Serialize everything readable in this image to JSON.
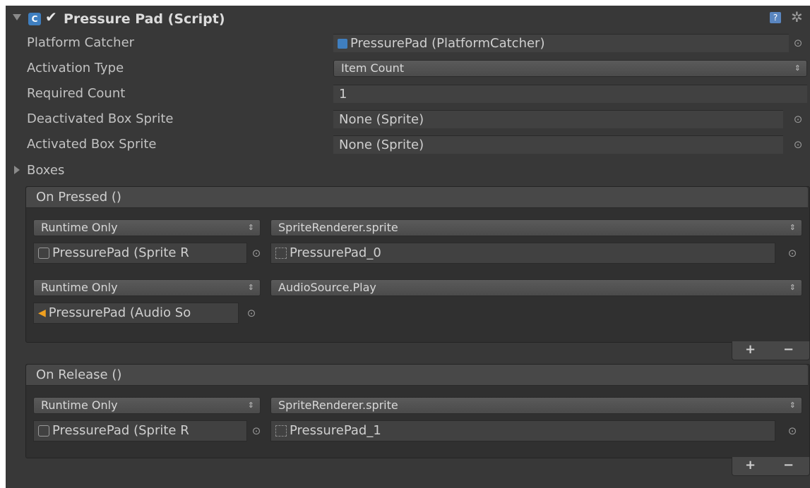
{
  "component": {
    "title": "Pressure Pad (Script)",
    "enabled": true,
    "icons": [
      "script-icon",
      "help-icon",
      "gear-icon",
      "foldout-arrow-icon"
    ]
  },
  "properties": [
    {
      "label": "Platform Catcher",
      "value": "PressurePad (PlatformCatcher)",
      "kind": "object"
    },
    {
      "label": "Activation Type",
      "value": "Item Count",
      "kind": "enum"
    },
    {
      "label": "Required Count",
      "value": "1",
      "kind": "int"
    },
    {
      "label": "Deactivated Box Sprite",
      "value": "None (Sprite)",
      "kind": "object"
    },
    {
      "label": "Activated Box Sprite",
      "value": "None (Sprite)",
      "kind": "object"
    }
  ],
  "boxes_label": "Boxes",
  "events": [
    {
      "title": "On Pressed ()",
      "listeners": [
        {
          "mode": "Runtime Only",
          "function": "SpriteRenderer.sprite",
          "target": "PressurePad (Sprite R",
          "arg": "PressurePad_0"
        },
        {
          "mode": "Runtime Only",
          "function": "AudioSource.Play",
          "target": "PressurePad (Audio So",
          "arg": ""
        }
      ]
    },
    {
      "title": "On Release ()",
      "listeners": [
        {
          "mode": "Runtime Only",
          "function": "SpriteRenderer.sprite",
          "target": "PressurePad (Sprite R",
          "arg": "PressurePad_1"
        }
      ]
    }
  ],
  "buttons": {
    "add": "+",
    "remove": "−"
  },
  "colors": {
    "background": "#383838",
    "field": "#414141",
    "group": "#303030",
    "audio_icon": "#f0a020"
  }
}
